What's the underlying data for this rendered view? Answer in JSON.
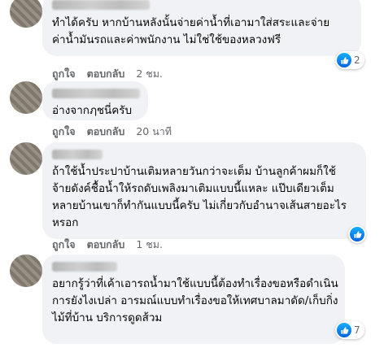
{
  "actions": {
    "like": "ถูกใจ",
    "reply": "ตอบกลับ"
  },
  "comments": [
    {
      "lines": [
        "ทำได้ครับ หากบ้านหลังนั้นจ่ายค่าน้ำที่เอามาใส่สระและจ่าย",
        "ค่าน้ำมันรถและค่าพนักงาน ไม่ใช่ใช้ของหลวงฟรี"
      ],
      "time": "2 ชม.",
      "likes": "2"
    },
    {
      "lines": [
        "อ่างจากฦชนี่ครับ"
      ],
      "time": "20 นาที",
      "likes": ""
    },
    {
      "lines": [
        "ถ้าใช้น้ำประปาบ้านเติมหลายวันกว่าจะเต็ม บ้านลูกค้าผมก็ใช้",
        "จ้ายดังค์ชื้อน้ำให้รถดับเพลิงมาเติมแบบนี้แหละ แป๊บเดียวเต็ม",
        "หลายบ้านเขาก็ทำกันแบบนี้ครับ ไม่เกี่ยวกับอำนาจเส้นสายอะไร",
        "หรอก"
      ],
      "time": "1 ชม.",
      "likes": ""
    },
    {
      "lines": [
        "อยากรู้ว่าที่เค้าเอารถน้ำมาใช้แบบนี้ต้องทำเรื่องขอหรือดำเนิน",
        "การยังไงเปล่า อารมณ์แบบทำเรื่องขอให้เทศบาลมาดัด/เก็บกิ่ง",
        "ไม้ที่บ้าน บริการดูดส้วม"
      ],
      "time": "",
      "likes": "7"
    }
  ]
}
